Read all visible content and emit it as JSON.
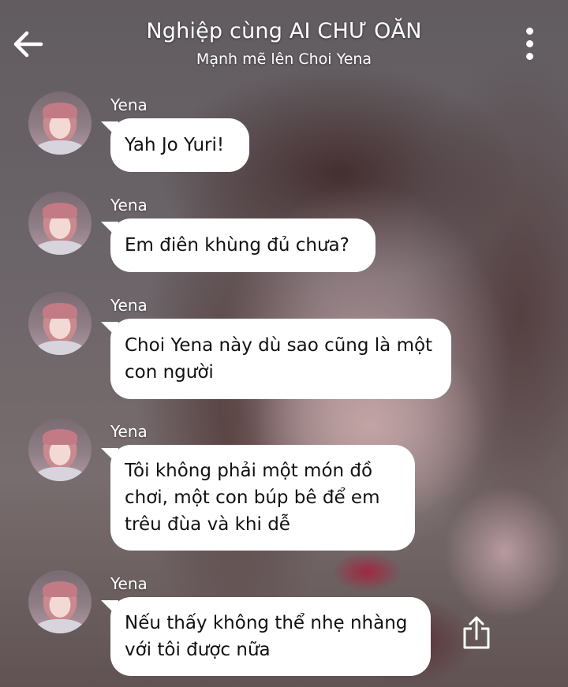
{
  "header": {
    "title": "Nghiệp cùng AI CHƯ OĂN",
    "subtitle": "Mạnh mẽ lên Choi Yena"
  },
  "icons": {
    "back": "arrow-left-icon",
    "more": "kebab-menu-icon",
    "share": "share-icon"
  },
  "colors": {
    "bubble": "#ffffff",
    "text": "#111111",
    "header_text": "#ffffff"
  },
  "messages": [
    {
      "sender": "Yena",
      "text": "Yah Jo Yuri!"
    },
    {
      "sender": "Yena",
      "text": "Em điên khùng đủ chưa?"
    },
    {
      "sender": "Yena",
      "text": "Choi Yena này dù sao cũng là một con người"
    },
    {
      "sender": "Yena",
      "text": "Tôi không phải một món đồ chơi, một con búp bê để em trêu đùa và khi dễ"
    },
    {
      "sender": "Yena",
      "text": "Nếu thấy không thể nhẹ nhàng với tôi được nữa"
    }
  ]
}
